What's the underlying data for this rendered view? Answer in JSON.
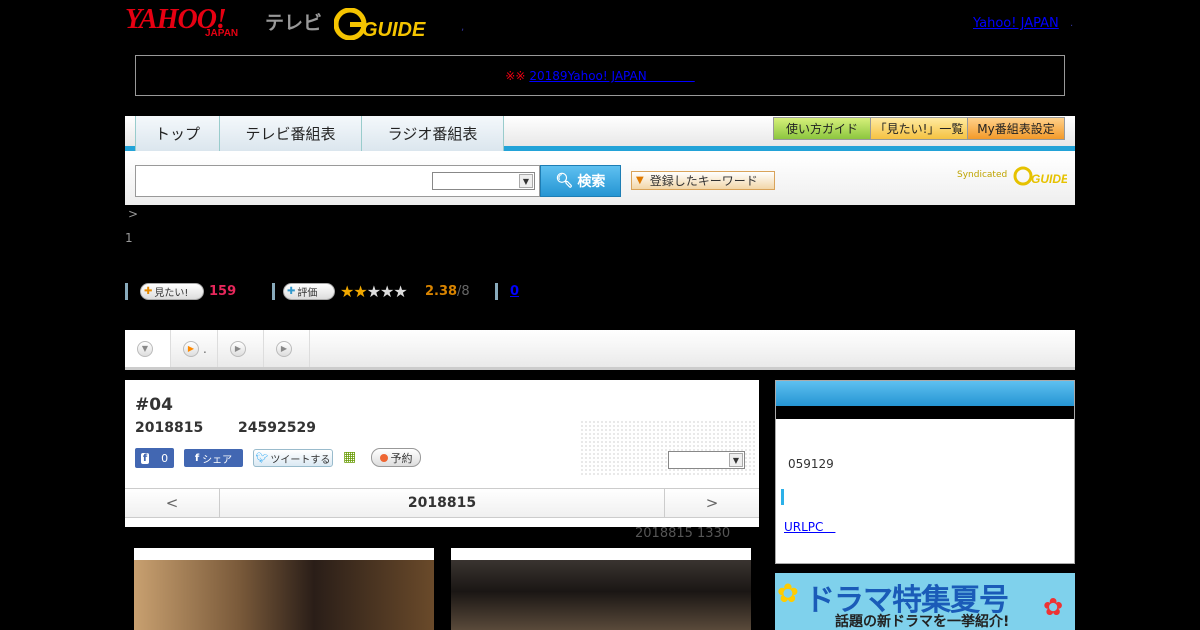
{
  "header": {
    "brand_yahoo": "YAHOO!",
    "brand_japan": "JAPAN",
    "brand_tv": "テレビ",
    "brand_guide": "GUIDE",
    "yahoo_link": "Yahoo! JAPAN",
    "dot": ",",
    "dot2": "."
  },
  "notice": {
    "mark": "※※",
    "link": "20189Yahoo! JAPAN　　　　"
  },
  "nav": {
    "tabs": [
      "トップ",
      "テレビ番組表",
      "ラジオ番組表"
    ],
    "guide_btn": "使い方ガイド",
    "mitai_btn": "「見たい!」一覧",
    "my_btn": "My番組表設定",
    "search_btn": "検索",
    "keyword_btn": "登録したキーワード",
    "syndicated": "Syndicated",
    "syndicated_logo": "GUIDE"
  },
  "breadcrumb": {
    "line1": ">",
    "line2": "1"
  },
  "stats": {
    "mitai_label": "見たい!",
    "mitai_count": "159",
    "hyoka_label": "評価",
    "stars_on": "★★",
    "stars_off": "★★★",
    "rating": "2.38",
    "rating_of": "/8",
    "comments": "0"
  },
  "play_tabs": {
    "tab2_label": "."
  },
  "program": {
    "episode": "#04",
    "date": "2018815",
    "time": "24592529",
    "fb_count": "0",
    "fb_share": "シェア",
    "tweet": "ツイートする",
    "reserve": "予約",
    "pager_prev": "<",
    "pager_date": "2018815",
    "pager_next": ">",
    "updated": "2018815  1330"
  },
  "side": {
    "time": "059129",
    "link": "URLPC　"
  },
  "banner": {
    "title": "ドラマ特集夏号",
    "subtitle": "話題の新ドラマを一挙紹介!"
  }
}
